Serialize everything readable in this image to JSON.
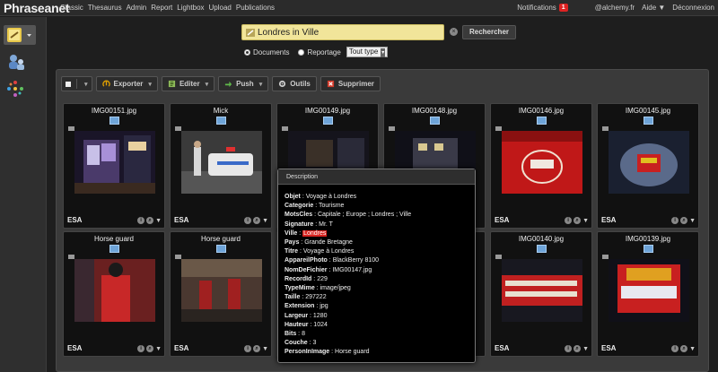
{
  "app": {
    "logo": "Phraseanet"
  },
  "nav": [
    "Classic",
    "Thesaurus",
    "Admin",
    "Report",
    "Lightbox",
    "Upload",
    "Publications"
  ],
  "user_nav": {
    "notifications": "Notifications",
    "notif_count": "1",
    "user": "@alchemy.fr",
    "help": "Aide ▼",
    "logout": "Déconnexion"
  },
  "search": {
    "query": "Londres in Ville",
    "button": "Rechercher",
    "radio_documents": "Documents",
    "radio_reportage": "Reportage",
    "type_select": "Tout type"
  },
  "toolbar": {
    "export": "Exporter",
    "edit": "Editer",
    "push": "Push",
    "tools": "Outils",
    "delete": "Supprimer"
  },
  "cards": [
    {
      "title": "IMG00151.jpg",
      "owner": "ESA"
    },
    {
      "title": "Mick",
      "owner": "ESA"
    },
    {
      "title": "IMG00149.jpg",
      "owner": ""
    },
    {
      "title": "IMG00148.jpg",
      "owner": ""
    },
    {
      "title": "IMG00146.jpg",
      "owner": "ESA"
    },
    {
      "title": "IMG00145.jpg",
      "owner": "ESA"
    },
    {
      "title": "Horse guard",
      "owner": "ESA"
    },
    {
      "title": "Horse guard",
      "owner": "ESA"
    },
    {
      "title": "",
      "owner": ""
    },
    {
      "title": "",
      "owner": ""
    },
    {
      "title": "IMG00140.jpg",
      "owner": "ESA"
    },
    {
      "title": "IMG00139.jpg",
      "owner": "ESA"
    }
  ],
  "tooltip": {
    "header": "Description",
    "fields": [
      {
        "k": "Objet",
        "v": "Voyage à Londres"
      },
      {
        "k": "Categorie",
        "v": "Tourisme"
      },
      {
        "k": "MotsCles",
        "v": "Capitale ; Europe ; Londres ; Ville"
      },
      {
        "k": "Signature",
        "v": "Mr. T"
      },
      {
        "k": "Ville",
        "v": "Londres",
        "highlight": true
      },
      {
        "k": "Pays",
        "v": "Grande Bretagne"
      },
      {
        "k": "Titre",
        "v": "Voyage à Londres"
      },
      {
        "k": "AppareilPhoto",
        "v": "BlackBerry 8100"
      },
      {
        "k": "NomDeFichier",
        "v": "IMG00147.jpg"
      },
      {
        "k": "RecordId",
        "v": "229"
      },
      {
        "k": "TypeMime",
        "v": "image/jpeg"
      },
      {
        "k": "Taille",
        "v": "297222"
      },
      {
        "k": "Extension",
        "v": "jpg"
      },
      {
        "k": "Largeur",
        "v": "1280"
      },
      {
        "k": "Hauteur",
        "v": "1024"
      },
      {
        "k": "Bits",
        "v": "8"
      },
      {
        "k": "Couche",
        "v": "3"
      },
      {
        "k": "PersonInImage",
        "v": "Horse guard"
      }
    ]
  }
}
